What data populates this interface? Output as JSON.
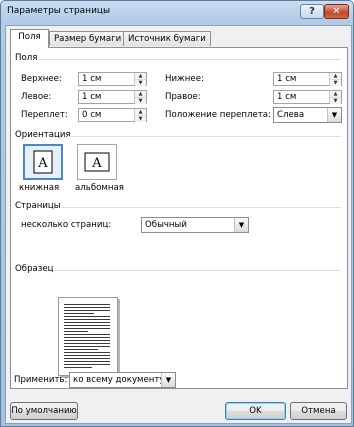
{
  "window": {
    "title": "Параметры страницы",
    "help_glyph": "?",
    "close_glyph": "✕"
  },
  "tabs": [
    "Поля",
    "Размер бумаги",
    "Источник бумаги"
  ],
  "margins": {
    "section": "Поля",
    "top_label": "Верхнее:",
    "top_value": "1 см",
    "bottom_label": "Нижнее:",
    "bottom_value": "1 см",
    "left_label": "Левое:",
    "left_value": "1 см",
    "right_label": "Правое:",
    "right_value": "1 см",
    "gutter_label": "Переплет:",
    "gutter_value": "0 см",
    "gutter_pos_label": "Положение переплета:",
    "gutter_pos_value": "Слева"
  },
  "orientation": {
    "section": "Ориентация",
    "portrait": "книжная",
    "landscape": "альбомная",
    "icon_letter": "A"
  },
  "pages": {
    "section": "Страницы",
    "multiple_label": "несколько страниц:",
    "multiple_value": "Обычный"
  },
  "sample": {
    "section": "Образец"
  },
  "apply": {
    "label": "Применить:",
    "value": "ко всему документу"
  },
  "buttons": {
    "default": "По умолчанию",
    "ok": "OK",
    "cancel": "Отмена"
  }
}
